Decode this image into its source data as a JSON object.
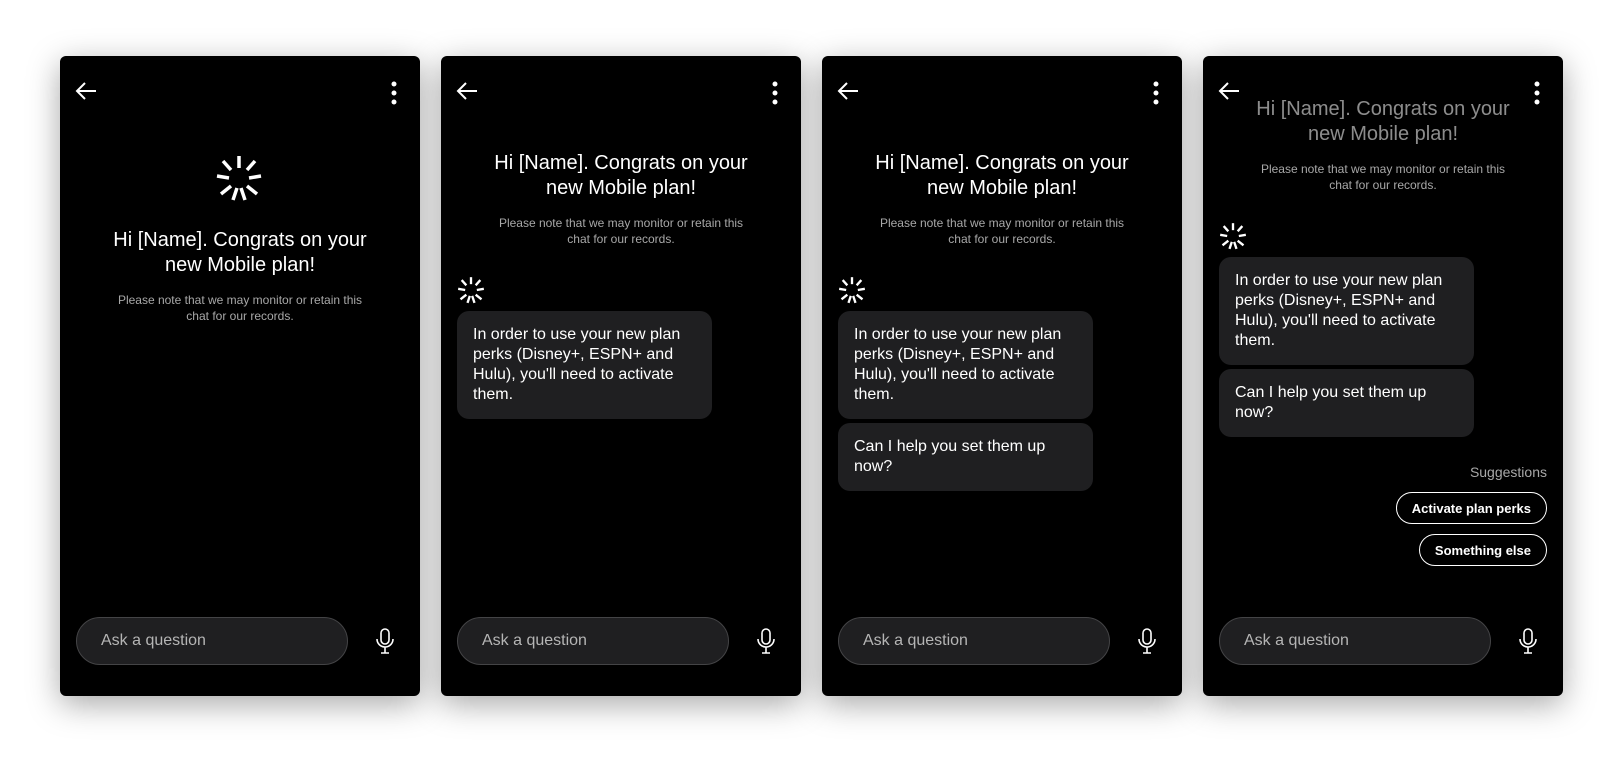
{
  "greeting": {
    "title": "Hi [Name]. Congrats on your new Mobile plan!",
    "note": "Please note that we may monitor or retain this chat for our records."
  },
  "messages": {
    "perks": "In order to use your new plan perks (Disney+, ESPN+ and Hulu), you'll need to activate them.",
    "help": "Can I help you set them up now?"
  },
  "suggestions": {
    "label": "Suggestions",
    "items": [
      "Activate plan perks",
      "Something else"
    ]
  },
  "input": {
    "placeholder": "Ask a question"
  },
  "icons": {
    "back": "arrow-left-icon",
    "more": "vertical-dots-icon",
    "logo": "sparkle-burst-icon",
    "mic": "microphone-icon"
  },
  "colors": {
    "screen_bg": "#000000",
    "bubble_bg": "#1f1f21",
    "text_primary": "#ffffff",
    "text_secondary": "#a8a8a8"
  }
}
